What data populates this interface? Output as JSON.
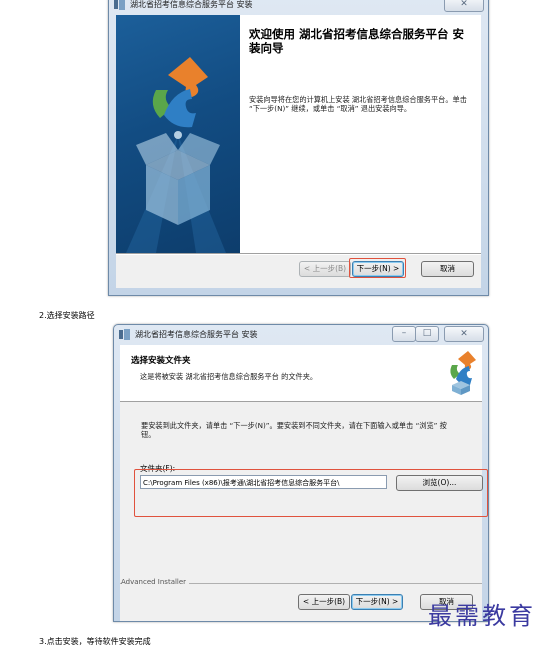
{
  "window1": {
    "title": "湖北省招考信息综合服务平台 安装",
    "close_label": "✕",
    "welcome_title": "欢迎使用 湖北省招考信息综合服务平台 安装向导",
    "welcome_body": "安装向导将在您的计算机上安装 湖北省招考信息综合服务平台。单击 “下一步(N)” 继续，或单击 “取消” 退出安装向导。",
    "back_label": "< 上一步(B)",
    "next_label": "下一步(N) >",
    "cancel_label": "取消"
  },
  "caption_step2": "2.选择安装路径",
  "window2": {
    "title": "湖北省招考信息综合服务平台 安装",
    "minimize_label": "–",
    "maximize_label": "□",
    "close_label": "✕",
    "header_title": "选择安装文件夹",
    "header_subtitle": "这是将被安装 湖北省招考信息综合服务平台 的文件夹。",
    "instructions": "要安装到此文件夹，请单击 “下一步(N)”。要安装到不同文件夹，请在下面输入或单击 “浏览” 按钮。",
    "folder_label": "文件夹(F):",
    "folder_value": "C:\\Program Files (x86)\\报考通\\湖北省招考信息综合服务平台\\",
    "browse_label": "浏览(O)...",
    "brand": "Advanced Installer",
    "back_label": "< 上一步(B)",
    "next_label": "下一步(N) >",
    "cancel_label": "取消"
  },
  "caption_step3": "3.点击安装，等待软件安装完成",
  "watermark": "最需教育",
  "colors": {
    "highlight": "#e0523d",
    "side_panel": "#124c82",
    "watermark": "#3b3aa0"
  }
}
